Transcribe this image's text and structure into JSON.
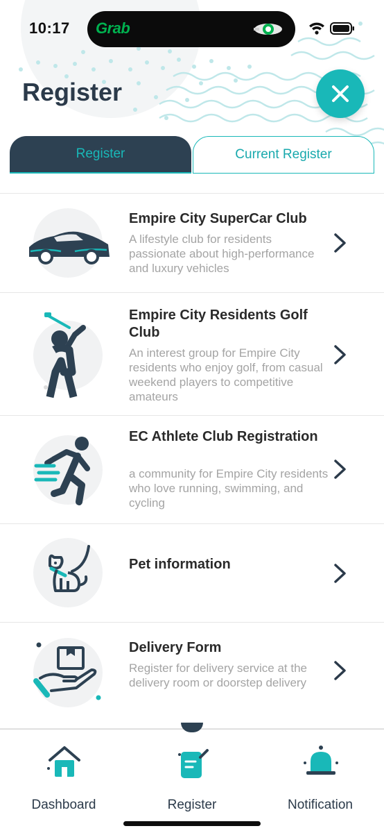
{
  "status_bar": {
    "time": "10:17",
    "activity_app": "Grab",
    "icons": [
      "grab-driver-icon",
      "wifi-icon",
      "battery-icon"
    ]
  },
  "header": {
    "title": "Register",
    "close_icon": "close-icon"
  },
  "tabs": [
    {
      "label": "Register",
      "active": true
    },
    {
      "label": "Current Register",
      "active": false
    }
  ],
  "register_items": [
    {
      "title": "Empire City SuperCar Club",
      "description": "A lifestyle club for residents passionate about high-performance and luxury vehicles",
      "icon": "sports-car-icon"
    },
    {
      "title": "Empire City Residents Golf Club",
      "description": "An interest group for Empire City residents who enjoy golf, from casual weekend players to competitive amateurs",
      "icon": "golfer-icon"
    },
    {
      "title": "EC Athlete Club Registration",
      "description": "a community for Empire City residents who love running, swimming, and cycling",
      "icon": "runner-icon"
    },
    {
      "title": "Pet information",
      "description": "",
      "icon": "dog-icon"
    },
    {
      "title": "Delivery Form",
      "description": "Register for delivery service at the delivery room or doorstep delivery",
      "icon": "delivery-package-icon"
    }
  ],
  "bottom_nav": [
    {
      "label": "Dashboard",
      "icon": "home-icon"
    },
    {
      "label": "Register",
      "icon": "register-form-icon",
      "active": true
    },
    {
      "label": "Notification",
      "icon": "bell-icon"
    }
  ],
  "colors": {
    "accent": "#19b8b8",
    "navy": "#2d4152",
    "title_text": "#2b3a4a",
    "desc_text": "#a4a4a4"
  }
}
